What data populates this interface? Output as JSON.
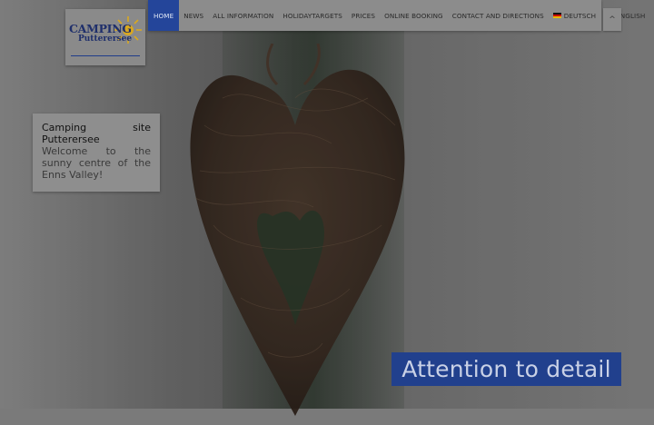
{
  "logo": {
    "line1": "CAMPING",
    "line2": "Putterersee"
  },
  "nav": {
    "items": [
      {
        "label": "HOME",
        "active": true
      },
      {
        "label": "NEWS"
      },
      {
        "label": "ALL INFORMATION"
      },
      {
        "label": "HOLIDAYTARGETS"
      },
      {
        "label": "PRICES"
      },
      {
        "label": "ONLINE BOOKING"
      },
      {
        "label": "CONTACT AND DIRECTIONS"
      },
      {
        "label": "DEUTSCH",
        "icon": "german-flag-icon"
      },
      {
        "label": "ENGLISH",
        "icon": "uk-flag-icon"
      }
    ],
    "active_color": "#24459a"
  },
  "scroll_top": {
    "icon": "chevron-up-icon",
    "glyph": "^"
  },
  "info": {
    "title": "Camping site Putterersee",
    "text": "Welcome to the sunny centre of the Enns Valley!"
  },
  "hero": {
    "caption": "Attention to detail",
    "caption_bg": "#21408d"
  }
}
